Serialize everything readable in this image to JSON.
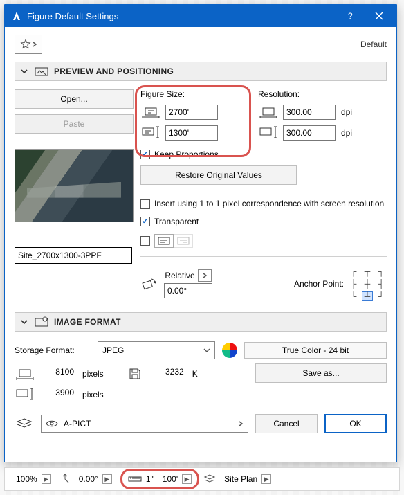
{
  "window": {
    "title": "Figure Default Settings"
  },
  "header": {
    "default_label": "Default"
  },
  "sections": {
    "preview": {
      "title": "PREVIEW AND POSITIONING"
    },
    "imgfmt": {
      "title": "IMAGE FORMAT"
    }
  },
  "leftcol": {
    "open_label": "Open...",
    "paste_label": "Paste",
    "filename": "Site_2700x1300-3PPF"
  },
  "size": {
    "label": "Figure Size:",
    "width": "2700'",
    "height": "1300'",
    "keep_label": "Keep Proportions",
    "restore_label": "Restore Original Values"
  },
  "res": {
    "label": "Resolution:",
    "x": "300.00",
    "y": "300.00",
    "unit": "dpi"
  },
  "options": {
    "insert_1to1": "Insert using 1 to 1 pixel correspondence with screen resolution",
    "transparent": "Transparent"
  },
  "rotation": {
    "relative_label": "Relative",
    "angle": "0.00°",
    "anchor_label": "Anchor Point:"
  },
  "imgfmt": {
    "storage_label": "Storage Format:",
    "storage_value": "JPEG",
    "color_value": "True Color - 24 bit",
    "px_w": "8100",
    "px_h": "3900",
    "px_unit": "pixels",
    "filesize": "3232",
    "filesize_unit": "K",
    "save_label": "Save as..."
  },
  "layer": {
    "name": "A-PICT"
  },
  "actions": {
    "cancel": "Cancel",
    "ok": "OK"
  },
  "status": {
    "zoom": "100%",
    "angle": "0.00°",
    "scale_left": "1\"",
    "scale_eq": "=100'",
    "view": "Site Plan"
  }
}
